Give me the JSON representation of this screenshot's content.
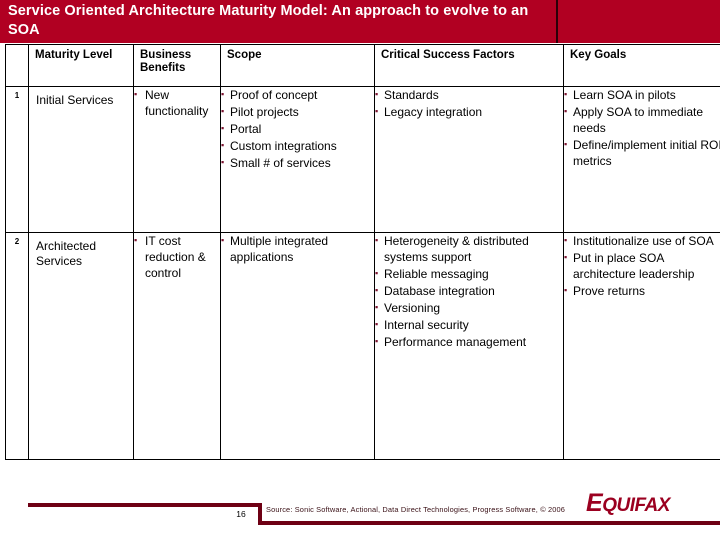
{
  "slide": {
    "title": "Service Oriented Architecture Maturity Model: An approach to evolve to an SOA",
    "accent_color": "#B10022",
    "header_row_color": "#CEE7F7",
    "bullet_color": "#7B1330"
  },
  "table": {
    "columns": [
      {
        "key": "num",
        "label": ""
      },
      {
        "key": "level",
        "label": "Maturity Level"
      },
      {
        "key": "ben",
        "label": "Business Benefits"
      },
      {
        "key": "scope",
        "label": "Scope"
      },
      {
        "key": "csf",
        "label": "Critical Success Factors"
      },
      {
        "key": "goals",
        "label": "Key Goals"
      }
    ],
    "rows": [
      {
        "number": "1",
        "level": "Initial Services",
        "business_benefits": [
          "New functionality"
        ],
        "scope": [
          "Proof of concept",
          "Pilot projects",
          "Portal",
          "Custom integrations",
          "Small # of services"
        ],
        "critical_success_factors": [
          "Standards",
          "Legacy integration"
        ],
        "key_goals": [
          "Learn SOA in pilots",
          "Apply SOA to immediate needs",
          "Define/implement initial ROI metrics"
        ]
      },
      {
        "number": "2",
        "level": "Architected Services",
        "business_benefits": [
          "IT cost reduction & control"
        ],
        "scope": [
          "Multiple integrated applications"
        ],
        "critical_success_factors": [
          "Heterogeneity & distributed systems support",
          "Reliable messaging",
          "Database integration",
          "Versioning",
          "Internal security",
          "Performance management"
        ],
        "key_goals": [
          "Institutionalize use of SOA",
          "Put in place SOA architecture leadership",
          "Prove returns"
        ]
      }
    ]
  },
  "footer": {
    "page_number": "16",
    "source": "Source: Sonic Software, Actional, Data Direct Technologies, Progress  Software, © 2006",
    "logo_first": "E",
    "logo_rest": "QUIFAX"
  }
}
